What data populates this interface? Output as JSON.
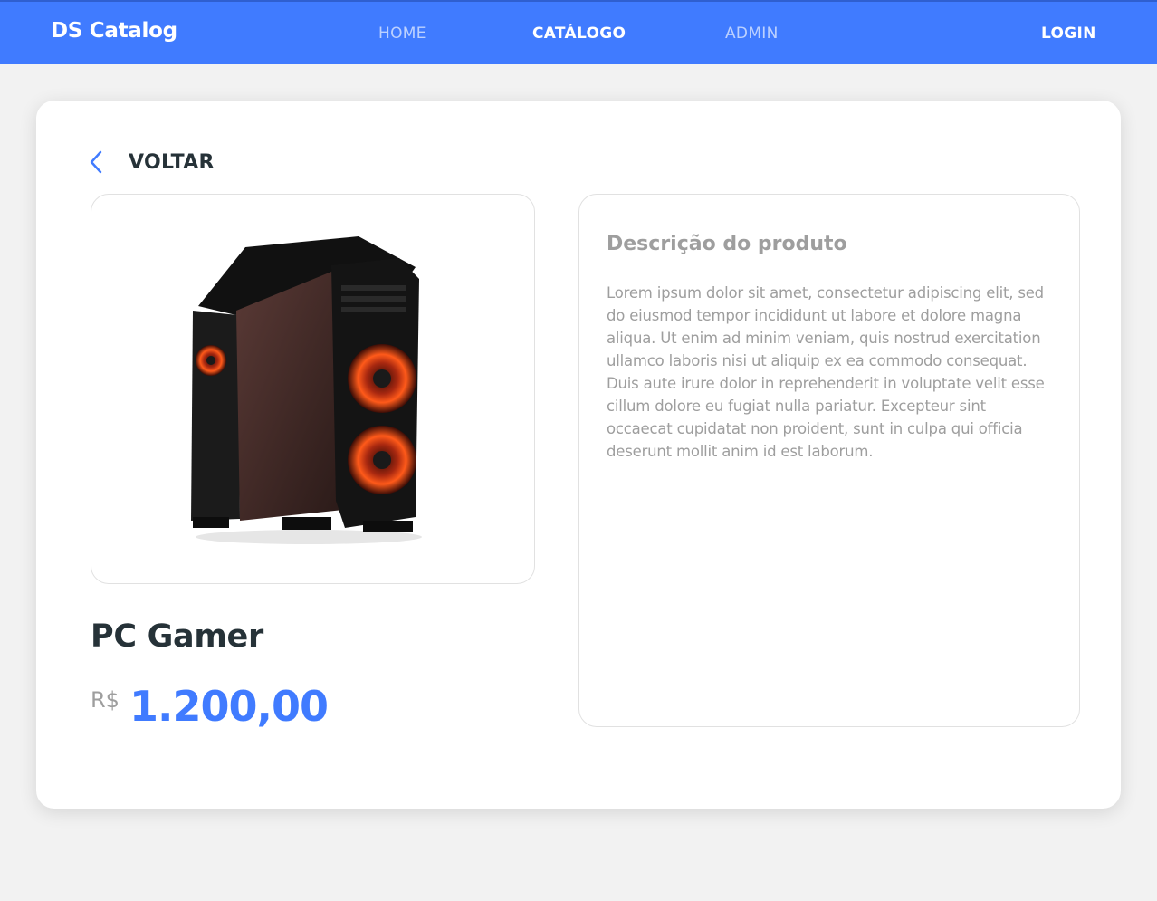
{
  "navbar": {
    "brand": "DS Catalog",
    "links": [
      "HOME",
      "CATÁLOGO",
      "ADMIN"
    ],
    "login": "LOGIN",
    "color": "#407bff"
  },
  "product": {
    "back_label": "VOLTAR",
    "image_icon": "pc-case-image",
    "name": "PC Gamer",
    "currency": "R$",
    "price": "1.200,00",
    "description_title": "Descrição do produto",
    "description": "Lorem ipsum dolor sit amet, consectetur adipiscing elit, sed do eiusmod tempor incididunt ut labore et dolore magna aliqua. Ut enim ad minim veniam, quis nostrud exercitation ullamco laboris nisi ut aliquip ex ea commodo consequat. Duis aute irure dolor in reprehenderit in voluptate velit esse cillum dolore eu fugiat nulla pariatur. Excepteur sint occaecat cupidatat non proident, sunt in culpa qui officia deserunt mollit anim id est laborum."
  }
}
